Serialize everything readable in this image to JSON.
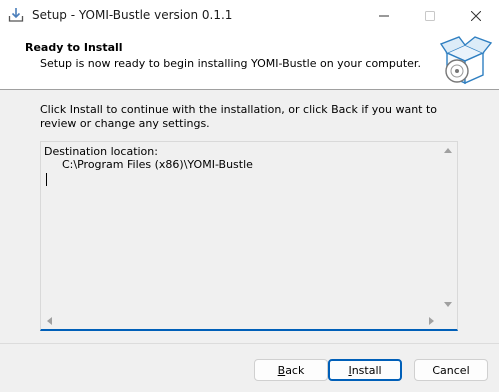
{
  "window": {
    "title": "Setup - YOMI-Bustle version 0.1.1",
    "icons": [
      "setup-download-icon",
      "minimize-icon",
      "maximize-icon",
      "close-icon"
    ]
  },
  "header": {
    "title": "Ready to Install",
    "subtitle": "Setup is now ready to begin installing YOMI-Bustle on your computer."
  },
  "body": {
    "instruction": "Click Install to continue with the installation, or click Back if you want to review or change any settings."
  },
  "memo": {
    "label": "Destination location:",
    "path": "C:\\Program Files (x86)\\YOMI-Bustle"
  },
  "buttons": {
    "back_accel": "B",
    "back_rest": "ack",
    "install_accel": "I",
    "install_rest": "nstall",
    "cancel": "Cancel"
  },
  "colors": {
    "accent": "#005fb8",
    "header_bg": "#ffffff",
    "dialog_bg": "#f0f0f0"
  }
}
